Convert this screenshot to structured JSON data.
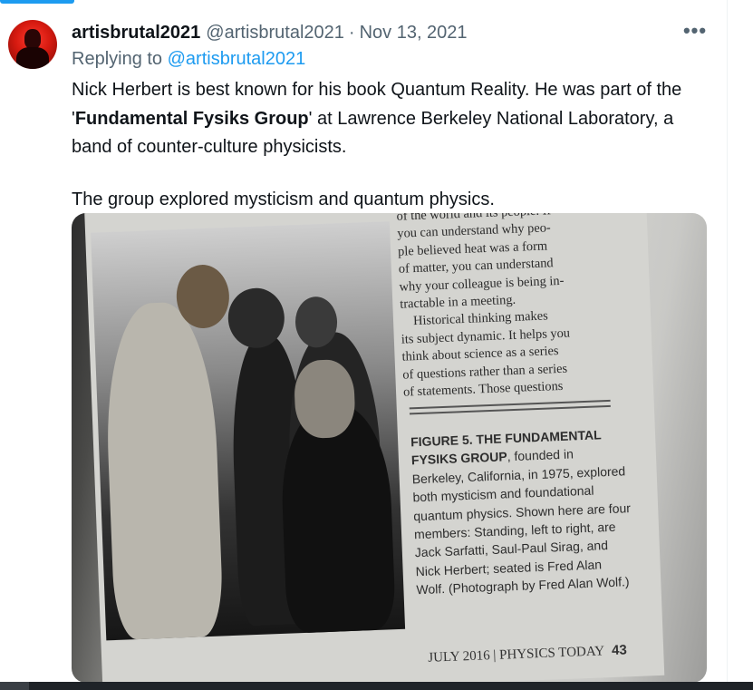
{
  "tweet": {
    "author_name": "artisbrutal2021",
    "author_handle": "@artisbrutal2021",
    "separator": "·",
    "date": "Nov 13, 2021",
    "more_icon": "more-horizontal-icon",
    "replying_prefix": "Replying to",
    "replying_to": "@artisbrutal2021",
    "text_1a": "Nick Herbert is best known for his book Quantum Reality. He was part of the '",
    "text_1b": "Fundamental Fysiks Group",
    "text_1c": "' at Lawrence Berkeley National Laboratory, a band of counter-culture physicists.",
    "text_2": "The group explored mysticism and quantum physics."
  },
  "media": {
    "page_lines": [
      "of the world and its people. If",
      "you can understand why peo-",
      "ple believed heat was a form",
      "of matter, you can understand",
      "why your colleague is being in-",
      "tractable in a meeting."
    ],
    "para2_lines": [
      "Historical thinking makes",
      "its subject dynamic. It helps you",
      "think about science as a series",
      "of questions rather than a series",
      "of statements. Those questions"
    ],
    "caption_head": "FIGURE 5. THE FUNDAMENTAL FYSIKS GROUP",
    "caption_body": ", founded in Berkeley, California, in 1975, explored both mysticism and foundational quantum physics. Shown here are four members: Standing, left to right, are Jack Sarfatti, Saul-Paul Sirag, and Nick Herbert; seated is Fred Alan Wolf. (Photograph by Fred Alan Wolf.)",
    "footer_issue": "JULY 2016 | PHYSICS TODAY",
    "footer_page": "43"
  },
  "colors": {
    "accent": "#1d9bf0",
    "secondary_text": "#536471",
    "primary_text": "#0f1419"
  }
}
